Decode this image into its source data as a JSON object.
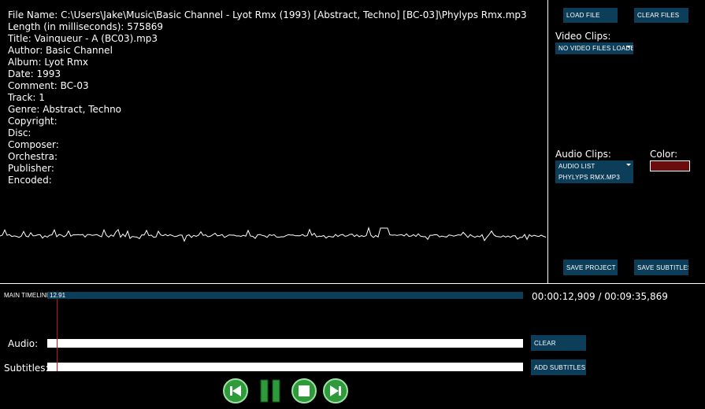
{
  "metadata": {
    "lines": [
      "File Name: C:\\Users\\Jake\\Music\\Basic Channel - Lyot Rmx (1993) [Abstract, Techno] [BC-03]\\Phylyps Rmx.mp3",
      "Length (in milliseconds): 575869",
      "Title: Vainqueur - A (BC03).mp3",
      "Author: Basic Channel",
      "Album: Lyot Rmx",
      "Date: 1993",
      "Comment: BC-03",
      "Track: 1",
      "Genre: Abstract, Techno",
      "Copyright:",
      "Disc:",
      "Composer:",
      "Orchestra:",
      "Publisher:",
      "Encoded:"
    ]
  },
  "right_panel": {
    "load_file": "LOAD FILE",
    "clear_files": "CLEAR FILES",
    "video_clips_label": "Video Clips:",
    "video_dropdown": "NO VIDEO FILES LOADED",
    "audio_clips_label": "Audio Clips:",
    "color_label": "Color:",
    "color_value": "#6b0d0d",
    "audio_dropdown": "AUDIO LIST",
    "audio_item": "PHYLYPS RMX.MP3",
    "save_project": "SAVE PROJECT",
    "save_subtitles": "SAVE SUBTITLES"
  },
  "timeline": {
    "label": "MAIN TIMELINE",
    "value": "12.91",
    "time_readout": "00:00:12,909 / 00:09:35,869",
    "audio_label": "Audio:",
    "subtitles_label": "Subtitles:",
    "clear_button": "CLEAR",
    "add_subtitles_button": "ADD SUBTITLES"
  },
  "controls": {
    "rewind_icon": "rewind-icon",
    "pause_icon": "pause-icon",
    "stop_icon": "stop-icon",
    "forward_icon": "fast-forward-icon"
  },
  "colors": {
    "accent": "#0c3d59",
    "playhead": "#c0141a",
    "control_green": "#2e9a3a"
  }
}
